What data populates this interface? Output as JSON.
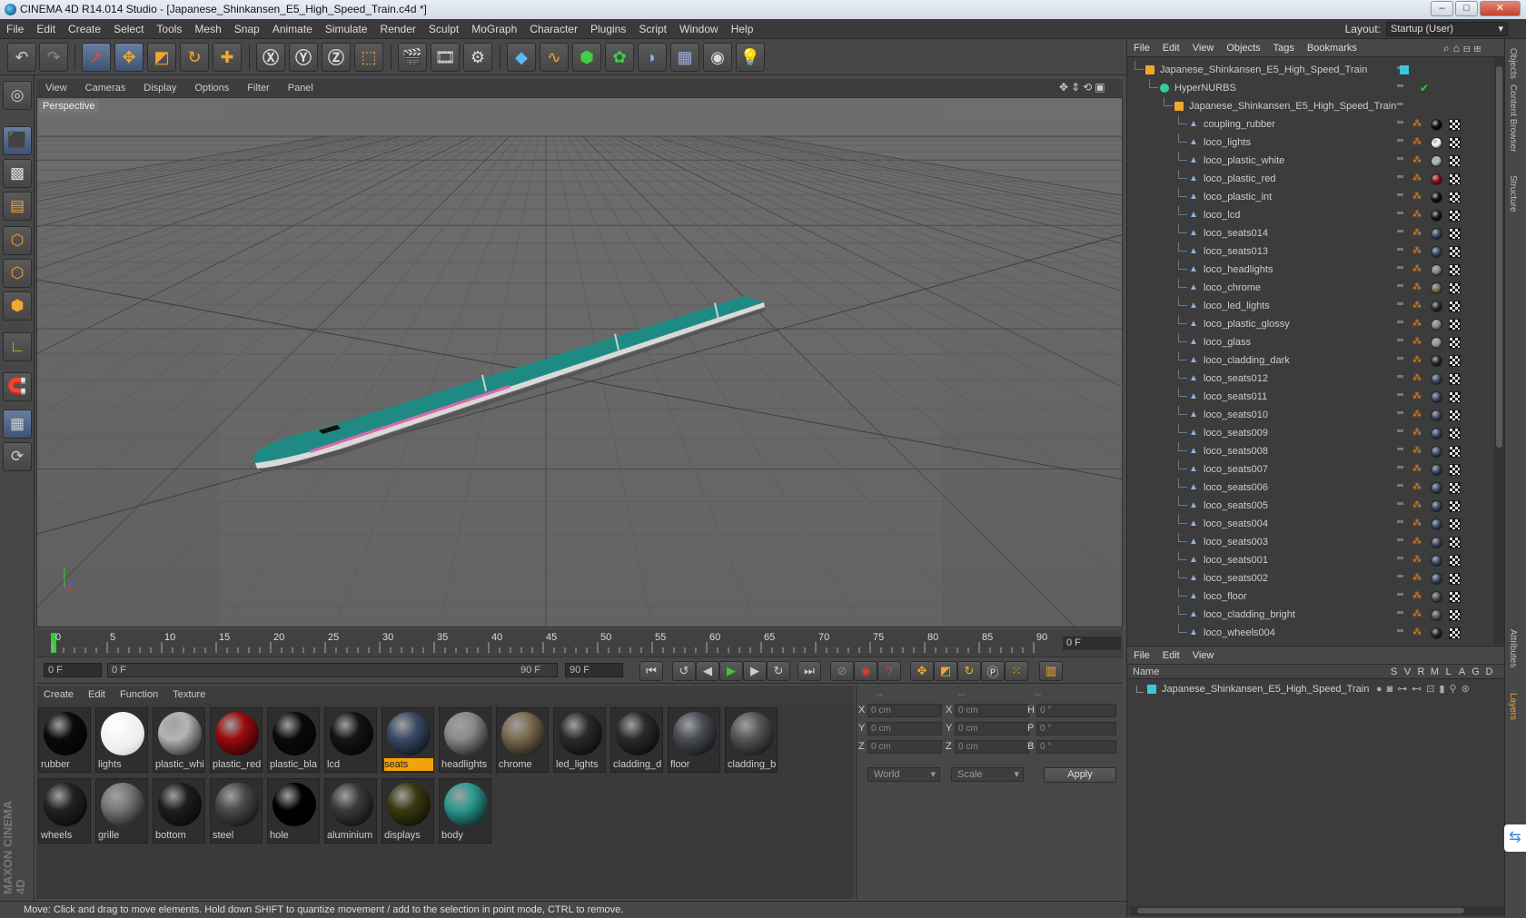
{
  "window": {
    "title": "CINEMA 4D R14.014 Studio - [Japanese_Shinkansen_E5_High_Speed_Train.c4d *]",
    "minimize": "–",
    "maximize": "□",
    "close": "✕"
  },
  "menubar": [
    "File",
    "Edit",
    "Create",
    "Select",
    "Tools",
    "Mesh",
    "Snap",
    "Animate",
    "Simulate",
    "Render",
    "Sculpt",
    "MoGraph",
    "Character",
    "Plugins",
    "Script",
    "Window",
    "Help"
  ],
  "layout": {
    "label": "Layout:",
    "value": "Startup (User)"
  },
  "viewport": {
    "menu": [
      "View",
      "Cameras",
      "Display",
      "Options",
      "Filter",
      "Panel"
    ],
    "label": "Perspective"
  },
  "timeline": {
    "ticks": [
      "0",
      "5",
      "10",
      "15",
      "20",
      "25",
      "30",
      "35",
      "40",
      "45",
      "50",
      "55",
      "60",
      "65",
      "70",
      "75",
      "80",
      "85",
      "90"
    ],
    "current_frame": "0 F"
  },
  "transport": {
    "start": "0 F",
    "range_start": "0 F",
    "range_end": "90 F",
    "end": "90 F"
  },
  "materials": {
    "menu": [
      "Create",
      "Edit",
      "Function",
      "Texture"
    ],
    "items": [
      {
        "name": "rubber",
        "color": "#0a0a0a"
      },
      {
        "name": "lights",
        "color": "#ffffff"
      },
      {
        "name": "plastic_whi",
        "color": "#b5b5b5"
      },
      {
        "name": "plastic_red",
        "color": "#9a0b0b"
      },
      {
        "name": "plastic_bla",
        "color": "#0b0b0b"
      },
      {
        "name": "lcd",
        "color": "#141414"
      },
      {
        "name": "seats",
        "color": "#3a4a66",
        "selected": true
      },
      {
        "name": "headlights",
        "color": "#8a8a8a"
      },
      {
        "name": "chrome",
        "color": "#7a6a50"
      },
      {
        "name": "led_lights",
        "color": "#2a2a2a"
      },
      {
        "name": "cladding_d",
        "color": "#2a2a2a"
      },
      {
        "name": "floor",
        "color": "#4a4d55"
      },
      {
        "name": "cladding_b",
        "color": "#555555"
      },
      {
        "name": "wheels",
        "color": "#222222"
      },
      {
        "name": "grille",
        "color": "#777777"
      },
      {
        "name": "bottom",
        "color": "#1e1e1e"
      },
      {
        "name": "steel",
        "color": "#4a4a4a"
      },
      {
        "name": "hole",
        "color": "#000000"
      },
      {
        "name": "aluminium",
        "color": "#3a3a3a"
      },
      {
        "name": "displays",
        "color": "#3a3a10"
      },
      {
        "name": "body",
        "color": "#2a9a90"
      }
    ]
  },
  "coords": {
    "headers": [
      "--",
      "--",
      "--"
    ],
    "rows": [
      {
        "a": "X",
        "av": "0 cm",
        "b": "X",
        "bv": "0 cm",
        "c": "H",
        "cv": "0 °"
      },
      {
        "a": "Y",
        "av": "0 cm",
        "b": "Y",
        "bv": "0 cm",
        "c": "P",
        "cv": "0 °"
      },
      {
        "a": "Z",
        "av": "0 cm",
        "b": "Z",
        "bv": "0 cm",
        "c": "B",
        "cv": "0 °"
      }
    ],
    "mode": "World",
    "transform": "Scale",
    "apply": "Apply"
  },
  "status": "Move: Click and drag to move elements. Hold down SHIFT to quantize movement / add to the selection in point mode, CTRL to remove.",
  "objects": {
    "menu": [
      "File",
      "Edit",
      "View",
      "Objects",
      "Tags",
      "Bookmarks"
    ],
    "root": "Japanese_Shinkansen_E5_High_Speed_Train",
    "nurbs": "HyperNURBS",
    "group": "Japanese_Shinkansen_E5_High_Speed_Train",
    "children": [
      {
        "name": "coupling_rubber",
        "tag": "#0a0a0a"
      },
      {
        "name": "loco_lights",
        "tag": "#ffffff"
      },
      {
        "name": "loco_plastic_white",
        "tag": "#b5b5b5"
      },
      {
        "name": "loco_plastic_red",
        "tag": "#9a0b0b"
      },
      {
        "name": "loco_plastic_int",
        "tag": "#0b0b0b"
      },
      {
        "name": "loco_lcd",
        "tag": "#141414"
      },
      {
        "name": "loco_seats014",
        "tag": "#3a4a66"
      },
      {
        "name": "loco_seats013",
        "tag": "#3a4a66"
      },
      {
        "name": "loco_headlights",
        "tag": "#8a8a8a"
      },
      {
        "name": "loco_chrome",
        "tag": "#7a6a50"
      },
      {
        "name": "loco_led_lights",
        "tag": "#2a2a2a"
      },
      {
        "name": "loco_plastic_glossy",
        "tag": "#888888"
      },
      {
        "name": "loco_glass",
        "tag": "#999999"
      },
      {
        "name": "loco_cladding_dark",
        "tag": "#2a2a2a"
      },
      {
        "name": "loco_seats012",
        "tag": "#3a4a66"
      },
      {
        "name": "loco_seats011",
        "tag": "#3a4a66"
      },
      {
        "name": "loco_seats010",
        "tag": "#3a4a66"
      },
      {
        "name": "loco_seats009",
        "tag": "#3a4a66"
      },
      {
        "name": "loco_seats008",
        "tag": "#3a4a66"
      },
      {
        "name": "loco_seats007",
        "tag": "#3a4a66"
      },
      {
        "name": "loco_seats006",
        "tag": "#3a4a66"
      },
      {
        "name": "loco_seats005",
        "tag": "#3a4a66"
      },
      {
        "name": "loco_seats004",
        "tag": "#3a4a66"
      },
      {
        "name": "loco_seats003",
        "tag": "#3a4a66"
      },
      {
        "name": "loco_seats001",
        "tag": "#3a4a66"
      },
      {
        "name": "loco_seats002",
        "tag": "#3a4a66"
      },
      {
        "name": "loco_floor",
        "tag": "#4a4d55"
      },
      {
        "name": "loco_cladding_bright",
        "tag": "#555555"
      },
      {
        "name": "loco_wheels004",
        "tag": "#222222"
      }
    ]
  },
  "layers": {
    "menu": [
      "File",
      "Edit",
      "View"
    ],
    "col_name": "Name",
    "cols": [
      "S",
      "V",
      "R",
      "M",
      "L",
      "A",
      "G",
      "D"
    ],
    "row": "Japanese_Shinkansen_E5_High_Speed_Train",
    "color": "#3cc8dc"
  },
  "sidetabs": [
    "Objects",
    "Content Browser",
    "Structure",
    "Attributes",
    "Layers"
  ],
  "brand": "MAXON CINEMA 4D"
}
